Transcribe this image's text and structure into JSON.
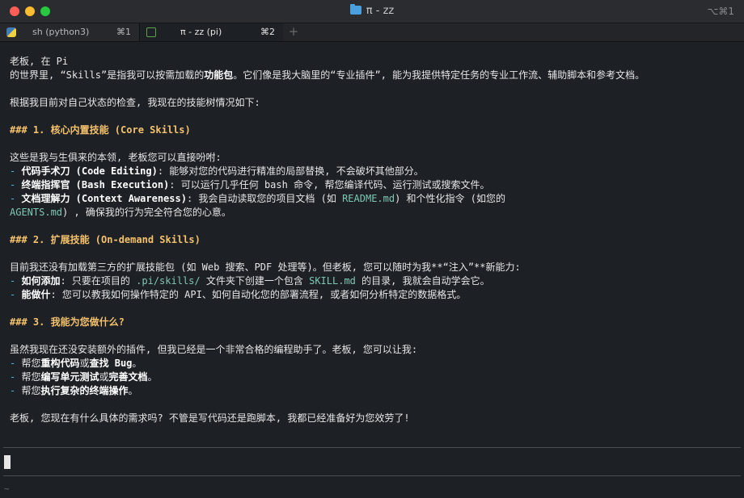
{
  "window": {
    "title": "π - zz",
    "shortcut": "⌥⌘1"
  },
  "tabs": [
    {
      "label": "sh (python3)",
      "key": "⌘1"
    },
    {
      "label": "π - zz (pi)",
      "key": "⌘2"
    }
  ],
  "new_tab": "+",
  "lines": [
    [
      {
        "t": "老板, 在 Pi"
      }
    ],
    [
      {
        "t": "的世界里, “Skills”是指我可以按需加载的"
      },
      {
        "t": "功能包",
        "c": "bold"
      },
      {
        "t": "。它们像是我大脑里的“专业插件”, 能为我提供特定任务的专业工作流、辅助脚本和参考文档。"
      }
    ],
    [],
    [
      {
        "t": "根据我目前对自己状态的检查, 我现在的技能树情况如下:"
      }
    ],
    [],
    [
      {
        "t": "### 1. 核心内置技能 (Core Skills)",
        "c": "heading"
      }
    ],
    [],
    [
      {
        "t": "这些是我与生俱来的本领, 老板您可以直接吩咐:"
      }
    ],
    [
      {
        "t": "- ",
        "c": "dash"
      },
      {
        "t": "代码手术刀 (Code Editing)",
        "c": "bold"
      },
      {
        "t": ": 能够对您的代码进行精准的局部替换, 不会破坏其他部分。"
      }
    ],
    [
      {
        "t": "- ",
        "c": "dash"
      },
      {
        "t": "终端指挥官 (Bash Execution)",
        "c": "bold"
      },
      {
        "t": ": 可以运行几乎任何 bash 命令, 帮您编译代码、运行测试或搜索文件。"
      }
    ],
    [
      {
        "t": "- ",
        "c": "dash"
      },
      {
        "t": "文档理解力 (Context Awareness)",
        "c": "bold"
      },
      {
        "t": ": 我会自动读取您的项目文档 (如 "
      },
      {
        "t": "README.md",
        "c": "code"
      },
      {
        "t": ") 和个性化指令 (如您的"
      }
    ],
    [
      {
        "t": "AGENTS.md",
        "c": "code"
      },
      {
        "t": ") , 确保我的行为完全符合您的心意。"
      }
    ],
    [],
    [
      {
        "t": "### 2. 扩展技能 (On-demand Skills)",
        "c": "heading"
      }
    ],
    [],
    [
      {
        "t": "目前我还没有加载第三方的扩展技能包 (如 Web 搜索、PDF 处理等)。但老板, 您可以随时为我**“注入”**新能力:"
      }
    ],
    [
      {
        "t": "- ",
        "c": "dash"
      },
      {
        "t": "如何添加",
        "c": "bold"
      },
      {
        "t": ": 只要在项目的 "
      },
      {
        "t": ".pi/skills/",
        "c": "code"
      },
      {
        "t": " 文件夹下创建一个包含 "
      },
      {
        "t": "SKILL.md",
        "c": "code"
      },
      {
        "t": " 的目录, 我就会自动学会它。"
      }
    ],
    [
      {
        "t": "- ",
        "c": "dash"
      },
      {
        "t": "能做什",
        "c": "bold"
      },
      {
        "t": ": 您可以教我如何操作特定的 API、如何自动化您的部署流程, 或者如何分析特定的数据格式。"
      }
    ],
    [],
    [
      {
        "t": "### 3. 我能为您做什么?",
        "c": "heading"
      }
    ],
    [],
    [
      {
        "t": "虽然我现在还没安装额外的插件, 但我已经是一个非常合格的编程助手了。老板, 您可以让我:"
      }
    ],
    [
      {
        "t": "- ",
        "c": "dash"
      },
      {
        "t": "帮您"
      },
      {
        "t": "重构代码",
        "c": "bold"
      },
      {
        "t": "或"
      },
      {
        "t": "查找 Bug",
        "c": "bold"
      },
      {
        "t": "。"
      }
    ],
    [
      {
        "t": "- ",
        "c": "dash"
      },
      {
        "t": "帮您"
      },
      {
        "t": "编写单元测试",
        "c": "bold"
      },
      {
        "t": "或"
      },
      {
        "t": "完善文档",
        "c": "bold"
      },
      {
        "t": "。"
      }
    ],
    [
      {
        "t": "- ",
        "c": "dash"
      },
      {
        "t": "帮您"
      },
      {
        "t": "执行复杂的终端操作",
        "c": "bold"
      },
      {
        "t": "。"
      }
    ],
    [],
    [
      {
        "t": "老板, 您现在有什么具体的需求吗? 不管是写代码还是跑脚本, 我都已经准备好为您效劳了!"
      }
    ]
  ],
  "footer": {
    "path": "~"
  }
}
